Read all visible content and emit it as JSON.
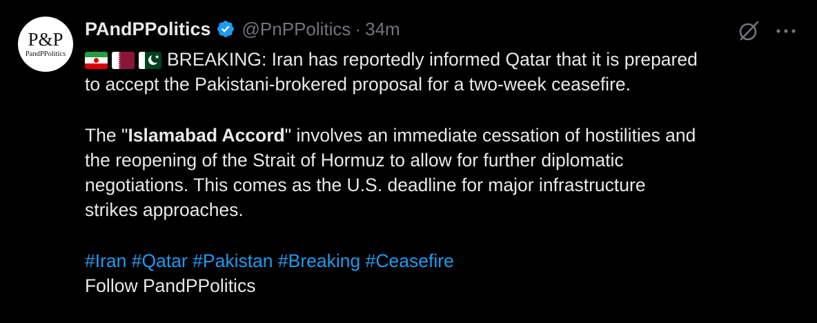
{
  "author": {
    "avatar_mark": "P&P",
    "avatar_subtext": "PandPPolitics",
    "display_name": "PAndPPolitics",
    "handle": "@PnPPolitics",
    "separator": "·",
    "time": "34m"
  },
  "icons": {
    "verified": "verified-badge-icon",
    "grok": "grok-icon",
    "more": "more-icon",
    "flags": [
      "iran-flag-icon",
      "qatar-flag-icon",
      "pakistan-flag-icon"
    ]
  },
  "colors": {
    "background": "#000000",
    "text": "#e7e9ea",
    "secondary": "#71767b",
    "link": "#1d9bf0",
    "verified": "#1d9bf0"
  },
  "tweet": {
    "para1_line1": "BREAKING: Iran has reportedly informed Qatar that it is prepared",
    "para1_line2": "to accept the Pakistani-brokered proposal for a two-week ceasefire.",
    "para2_prefix": "The \"",
    "para2_bold": "Islamabad Accord",
    "para2_line1_rest": "\" involves an immediate cessation of hostilities and",
    "para2_line2": "the reopening of the Strait of Hormuz to allow for further diplomatic",
    "para2_line3": "negotiations. This comes as the U.S. deadline for major infrastructure",
    "para2_line4": "strikes approaches.",
    "hashtags": [
      "#Iran",
      "#Qatar",
      "#Pakistan",
      "#Breaking",
      "#Ceasefire"
    ],
    "follow_line": "Follow PandPPolitics"
  }
}
